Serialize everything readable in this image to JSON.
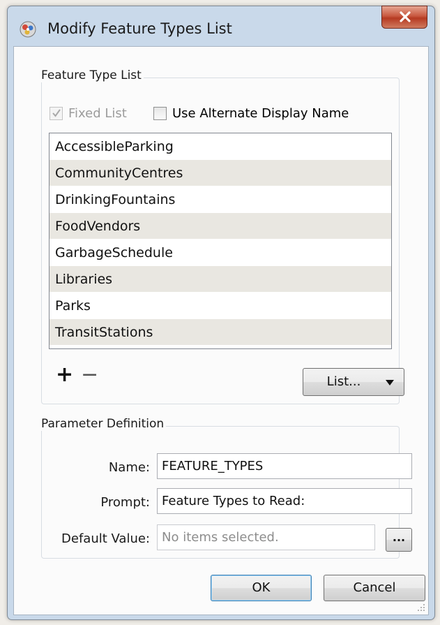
{
  "window": {
    "title": "Modify Feature Types List",
    "app_icon": "fme-workbench-icon",
    "close_icon": "close-icon"
  },
  "feature_type_list": {
    "group_title": "Feature Type List",
    "fixed_list": {
      "label": "Fixed List",
      "checked": true,
      "enabled": false
    },
    "use_alternate_display_name": {
      "label": "Use Alternate Display Name",
      "checked": false,
      "enabled": true
    },
    "items": [
      "AccessibleParking",
      "CommunityCentres",
      "DrinkingFountains",
      "FoodVendors",
      "GarbageSchedule",
      "Libraries",
      "Parks",
      "TransitStations"
    ],
    "add_label": "+",
    "remove_label": "−",
    "list_button_label": "List...",
    "list_button_icon": "triangle-down-icon"
  },
  "parameter_definition": {
    "group_title": "Parameter Definition",
    "name_label": "Name:",
    "name_value": "FEATURE_TYPES",
    "prompt_label": "Prompt:",
    "prompt_value": "Feature Types to Read:",
    "default_label": "Default Value:",
    "default_placeholder": "No items selected.",
    "browse_label": "..."
  },
  "buttons": {
    "ok_label": "OK",
    "cancel_label": "Cancel"
  },
  "colors": {
    "close_button": "#c8583f",
    "list_alt_row": "#e9e7e1",
    "default_button_border": "#3c7fb1"
  }
}
